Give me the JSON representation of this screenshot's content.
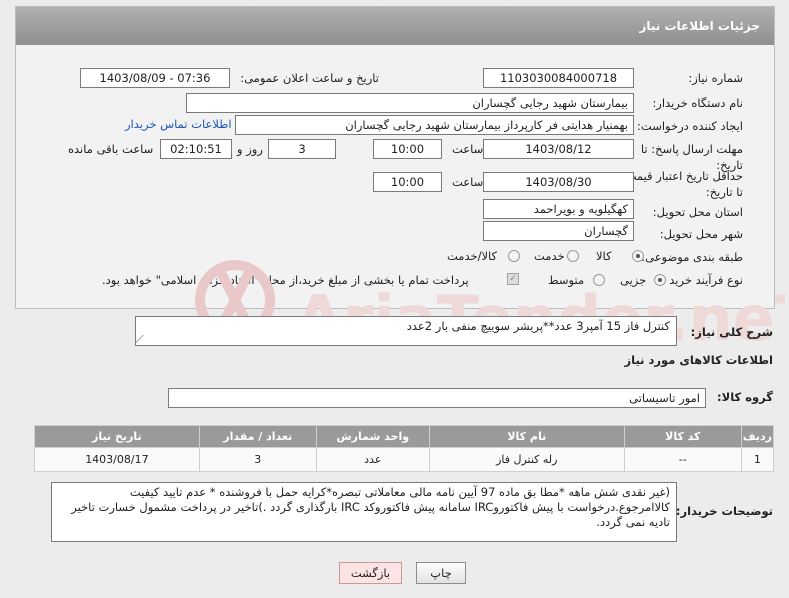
{
  "header": {
    "title": "جزئیات اطلاعات نیاز"
  },
  "form": {
    "need_number_label": "شماره نیاز:",
    "need_number": "1103030084000718",
    "announce_label": "تاریخ و ساعت اعلان عمومی:",
    "announce_value": "1403/08/09 - 07:36",
    "buyer_org_label": "نام دستگاه خریدار:",
    "buyer_org": "بیمارستان شهید رجایی گچساران",
    "requester_label": "ایجاد کننده درخواست:",
    "requester": "بهمنیار هدایتی فر کارپرداز بیمارستان شهید رجایی گچساران",
    "contact_link": "اطلاعات تماس خریدار",
    "deadline_label": "مهلت ارسال پاسخ: تا تاریخ:",
    "deadline_date": "1403/08/12",
    "time_label": "ساعت",
    "deadline_time": "10:00",
    "days_value": "3",
    "days_label": "روز و",
    "remaining_time": "02:10:51",
    "remaining_label": "ساعت باقی مانده",
    "validity_label": "حداقل تاریخ اعتبار قیمت: تا تاریخ:",
    "validity_date": "1403/08/30",
    "validity_time": "10:00",
    "province_label": "استان محل تحویل:",
    "province": "کهگیلویه و بویراحمد",
    "city_label": "شهر محل تحویل:",
    "city": "گچساران",
    "category_label": "طبقه بندی موضوعی:",
    "category_options": [
      "کالا",
      "خدمت",
      "کالا/خدمت"
    ],
    "category_selected": 0,
    "purchase_label": "نوع فرآیند خرید :",
    "purchase_options": [
      "جزیی",
      "متوسط"
    ],
    "purchase_selected": 0,
    "payment_note": "پرداخت تمام یا بخشی از مبلغ خرید،از محل \"اسناد خزانه اسلامی\" خواهد بود."
  },
  "summary": {
    "label": "شرح کلی نیاز:",
    "text": "کنترل فاز 15 آمپر3 عدد**پریشر سوییچ منفی بار 2عدد"
  },
  "goods": {
    "section_title": "اطلاعات کالاهای مورد نیاز",
    "group_label": "گروه کالا:",
    "group_value": "امور تاسیساتی",
    "columns": [
      "ردیف",
      "کد کالا",
      "نام کالا",
      "واحد شمارش",
      "تعداد / مقدار",
      "تاریخ نیاز"
    ],
    "rows": [
      [
        "1",
        "--",
        "رله کنترل فاز",
        "عدد",
        "3",
        "1403/08/17"
      ]
    ]
  },
  "buyer_notes": {
    "label": "توضیحات خریدار:",
    "text": "(غیر نقدی شش ماهه  *مطا بق ماده 97 آیین نامه مالی معاملاتی تبصره*کرایه حمل با فروشنده * عدم تایید کیفیت کالاامرجوع.درخواست با پیش فاکتوروIRC سامانه  پیش فاکتوروکد IRC بارگذاری گردد .)تاخیر در پرداخت مشمول خسارت تاخیر تادیه نمی گردد."
  },
  "buttons": {
    "print": "چاپ",
    "back": "بازگشت"
  },
  "watermark_text": "AriaTender.neT",
  "colors": {
    "header": "#9c9c9c",
    "link": "#1a56b8",
    "watermark": "#e8c8c8"
  }
}
